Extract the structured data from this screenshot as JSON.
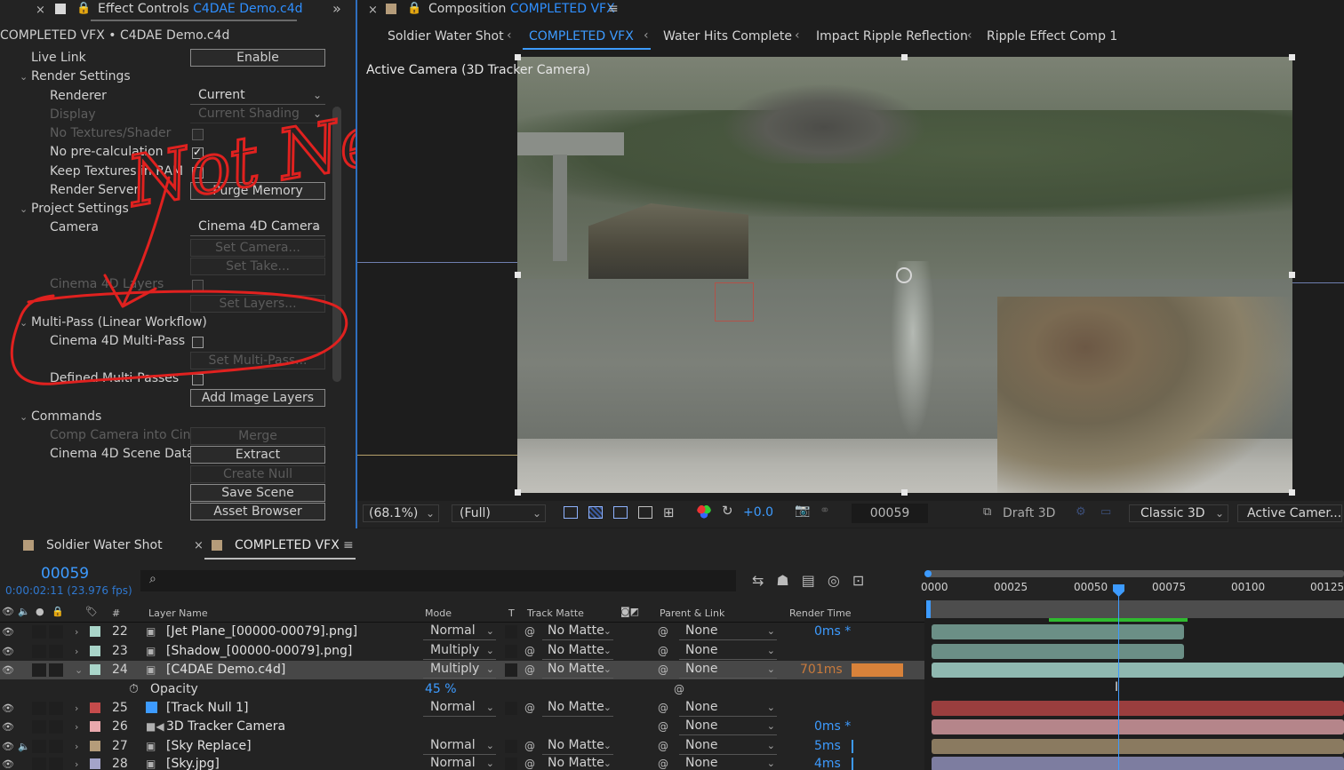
{
  "effect_panel": {
    "tab_title": "Effect Controls",
    "tab_file": "C4DAE Demo.c4d",
    "crumb": "COMPLETED VFX • C4DAE Demo.c4d",
    "rows": [
      {
        "label": "Live Link",
        "btn": "Enable"
      },
      {
        "label": "Render Settings"
      },
      {
        "label": "Renderer",
        "dd": "Current"
      },
      {
        "label": "Display",
        "dd": "Current Shading"
      },
      {
        "label": "No Textures/Shader"
      },
      {
        "label": "No pre-calculation"
      },
      {
        "label": "Keep Textures in RAM"
      },
      {
        "label": "Render Server",
        "btn": "Purge Memory"
      },
      {
        "label": "Project Settings"
      },
      {
        "label": "Camera",
        "dd": "Cinema 4D Camera"
      },
      {
        "btn": "Set Camera..."
      },
      {
        "btn": "Set Take..."
      },
      {
        "label": "Cinema 4D Layers"
      },
      {
        "btn": "Set Layers..."
      },
      {
        "label": "Multi-Pass (Linear Workflow)"
      },
      {
        "label": "Cinema 4D Multi-Pass"
      },
      {
        "btn": "Set Multi-Pass..."
      },
      {
        "label": "Defined Multi-Passes"
      },
      {
        "btn": "Add Image Layers"
      },
      {
        "label": "Commands"
      },
      {
        "label": "Comp Camera into Cine",
        "btn": "Merge"
      },
      {
        "label": "Cinema 4D Scene Data",
        "btn": "Extract"
      },
      {
        "btn": "Create Null"
      },
      {
        "btn": "Save Scene"
      },
      {
        "btn": "Asset Browser"
      }
    ],
    "annotation": "Not Needed"
  },
  "comp_panel": {
    "tab_title": "Composition",
    "tab_name": "COMPLETED VFX",
    "nav": [
      "Soldier Water Shot",
      "COMPLETED VFX",
      "Water Hits Complete",
      "Impact Ripple Reflection",
      "Ripple Effect Comp 1"
    ],
    "view_label": "Active Camera (3D Tracker Camera)",
    "footer": {
      "zoom": "(68.1%)",
      "resolution": "(Full)",
      "exposure": "+0.0",
      "frame": "00059",
      "draft": "Draft 3D",
      "renderer": "Classic 3D",
      "view": "Active Camer..."
    }
  },
  "timeline": {
    "tabs": [
      "Soldier Water Shot",
      "COMPLETED VFX"
    ],
    "timecode": "00059",
    "time_sub": "0:00:02:11 (23.976 fps)",
    "headers": {
      "layer_name": "Layer Name",
      "mode": "Mode",
      "t": "T",
      "track_matte": "Track Matte",
      "parent": "Parent & Link",
      "render_time": "Render Time",
      "num": "#"
    },
    "ruler": [
      "0000",
      "00025",
      "00050",
      "00075",
      "00100",
      "00125"
    ],
    "layers": [
      {
        "num": "22",
        "name": "[Jet Plane_[00000-00079].png]",
        "mode": "Normal",
        "matte": "No Matte",
        "parent": "None",
        "rt": "0ms *",
        "color": "#a9d5c9"
      },
      {
        "num": "23",
        "name": "[Shadow_[00000-00079].png]",
        "mode": "Multiply",
        "matte": "No Matte",
        "parent": "None",
        "rt": "",
        "color": "#a9d5c9"
      },
      {
        "num": "24",
        "name": "[C4DAE Demo.c4d]",
        "mode": "Multiply",
        "matte": "No Matte",
        "parent": "None",
        "rt": "701ms",
        "color": "#a9d5c9"
      },
      {
        "num": "",
        "name": "Opacity",
        "mode": "45 %",
        "matte": "",
        "parent": "",
        "rt": "",
        "color": ""
      },
      {
        "num": "25",
        "name": "[Track Null 1]",
        "mode": "Normal",
        "matte": "No Matte",
        "parent": "None",
        "rt": "",
        "color": "#c54b4b"
      },
      {
        "num": "26",
        "name": "3D Tracker Camera",
        "mode": "",
        "matte": "",
        "parent": "None",
        "rt": "0ms *",
        "color": "#e9a8ad"
      },
      {
        "num": "27",
        "name": "[Sky Replace]",
        "mode": "Normal",
        "matte": "No Matte",
        "parent": "None",
        "rt": "5ms",
        "color": "#b59c7a"
      },
      {
        "num": "28",
        "name": "[Sky.jpg]",
        "mode": "Normal",
        "matte": "No Matte",
        "parent": "None",
        "rt": "4ms",
        "color": "#a4a4c9"
      }
    ]
  }
}
